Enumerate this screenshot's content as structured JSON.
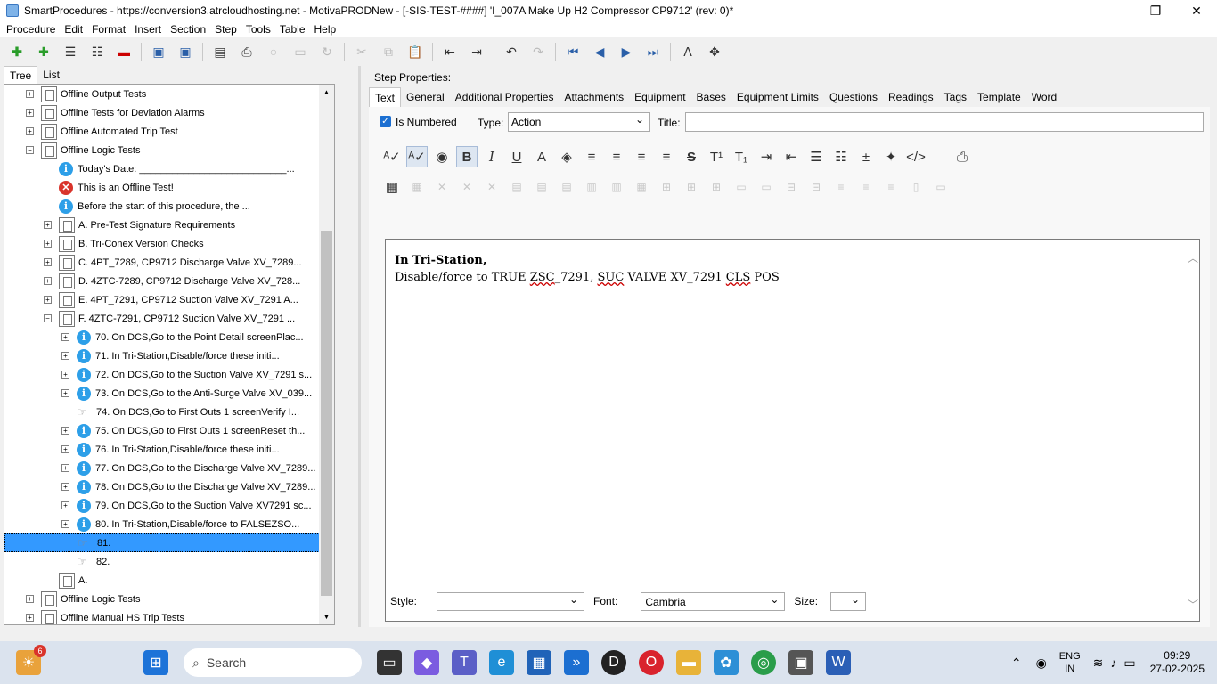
{
  "window": {
    "title": "SmartProcedures - https://conversion3.atrcloudhosting.net - MotivaPRODNew - [-SIS-TEST-####] 'I_007A Make Up H2 Compressor CP9712' (rev: 0)*",
    "controls": {
      "minimize": "—",
      "maximize": "❐",
      "close": "✕"
    }
  },
  "menu": [
    "Procedure",
    "Edit",
    "Format",
    "Insert",
    "Section",
    "Step",
    "Tools",
    "Table",
    "Help"
  ],
  "left_tabs": [
    "Tree",
    "List"
  ],
  "tree": [
    {
      "text": "Offline Output Tests",
      "icon": "doc",
      "indent": 0,
      "exp": "+"
    },
    {
      "text": "Offline Tests for Deviation Alarms",
      "icon": "doc",
      "indent": 0,
      "exp": "+"
    },
    {
      "text": "Offline Automated Trip Test",
      "icon": "doc",
      "indent": 0,
      "exp": "+"
    },
    {
      "text": "Offline Logic Tests",
      "icon": "doc",
      "indent": 0,
      "exp": "−"
    },
    {
      "text": "Today's Date: ___________________________...",
      "icon": "info",
      "indent": 1,
      "exp": ""
    },
    {
      "text": "This is an Offline Test!",
      "icon": "error",
      "indent": 1,
      "exp": ""
    },
    {
      "text": "Before the start of this procedure, the ...",
      "icon": "info",
      "indent": 1,
      "exp": ""
    },
    {
      "text": "A. Pre-Test Signature Requirements",
      "icon": "doc",
      "indent": 1,
      "exp": "+"
    },
    {
      "text": "B. Tri-Conex Version Checks",
      "icon": "doc",
      "indent": 1,
      "exp": "+"
    },
    {
      "text": "C. 4PT_7289, CP9712 Discharge Valve XV_7289...",
      "icon": "doc",
      "indent": 1,
      "exp": "+"
    },
    {
      "text": "D. 4ZTC-7289, CP9712 Discharge Valve XV_728...",
      "icon": "doc",
      "indent": 1,
      "exp": "+"
    },
    {
      "text": "E. 4PT_7291, CP9712 Suction Valve XV_7291 A...",
      "icon": "doc",
      "indent": 1,
      "exp": "+"
    },
    {
      "text": "F. 4ZTC-7291, CP9712 Suction Valve XV_7291 ...",
      "icon": "doc",
      "indent": 1,
      "exp": "−"
    },
    {
      "text": "70. On DCS,Go to the Point Detail screenPlac...",
      "icon": "info",
      "indent": 2,
      "exp": "+"
    },
    {
      "text": "71. In Tri-Station,Disable/force these initi...",
      "icon": "info",
      "indent": 2,
      "exp": "+"
    },
    {
      "text": "72. On DCS,Go to the Suction Valve XV_7291 s...",
      "icon": "info",
      "indent": 2,
      "exp": "+"
    },
    {
      "text": "73. On DCS,Go to the Anti-Surge Valve XV_039...",
      "icon": "info",
      "indent": 2,
      "exp": "+"
    },
    {
      "text": "74. On DCS,Go to First Outs 1 screenVerify I...",
      "icon": "hand",
      "indent": 2,
      "exp": ""
    },
    {
      "text": "75. On DCS,Go to First Outs 1 screenReset th...",
      "icon": "info",
      "indent": 2,
      "exp": "+"
    },
    {
      "text": "76. In Tri-Station,Disable/force these initi...",
      "icon": "info",
      "indent": 2,
      "exp": "+"
    },
    {
      "text": "77. On DCS,Go to the Discharge Valve XV_7289...",
      "icon": "info",
      "indent": 2,
      "exp": "+"
    },
    {
      "text": "78. On DCS,Go to the Discharge Valve XV_7289...",
      "icon": "info",
      "indent": 2,
      "exp": "+"
    },
    {
      "text": "79. On DCS,Go to the Suction Valve XV7291 sc...",
      "icon": "info",
      "indent": 2,
      "exp": "+"
    },
    {
      "text": "80. In Tri-Station,Disable/force to FALSEZSO...",
      "icon": "info",
      "indent": 2,
      "exp": "+"
    },
    {
      "text": "81.",
      "icon": "hand",
      "indent": 2,
      "exp": "",
      "selected": true
    },
    {
      "text": "82.",
      "icon": "hand",
      "indent": 2,
      "exp": ""
    },
    {
      "text": "A.",
      "icon": "doc",
      "indent": 1,
      "exp": ""
    },
    {
      "text": "Offline Logic Tests",
      "icon": "doc",
      "indent": 0,
      "exp": "+"
    },
    {
      "text": "Offline Manual HS Trip Tests",
      "icon": "doc",
      "indent": 0,
      "exp": "+"
    }
  ],
  "step_properties": {
    "heading": "Step Properties:",
    "tabs": [
      "Text",
      "General",
      "Additional Properties",
      "Attachments",
      "Equipment",
      "Bases",
      "Equipment Limits",
      "Questions",
      "Readings",
      "Tags",
      "Template",
      "Word"
    ],
    "is_numbered_label": "Is Numbered",
    "type_label": "Type:",
    "type_value": "Action",
    "title_label": "Title:",
    "title_value": ""
  },
  "editor": {
    "line1": "In Tri-Station,",
    "line2_a": "Disable/force to TRUE ",
    "line2_b": "ZSC",
    "line2_c": "_7291, ",
    "line2_d": "SUC",
    "line2_e": " VALVE XV_7291 ",
    "line2_f": "CLS",
    "line2_g": " POS"
  },
  "format_bottom": {
    "style_label": "Style:",
    "style_value": "",
    "font_label": "Font:",
    "font_value": "Cambria",
    "size_label": "Size:",
    "size_value": ""
  },
  "taskbar": {
    "weather_badge": "6",
    "search_placeholder": "Search",
    "lang_line1": "ENG",
    "lang_line2": "IN",
    "time": "09:29",
    "date": "27-02-2025"
  }
}
